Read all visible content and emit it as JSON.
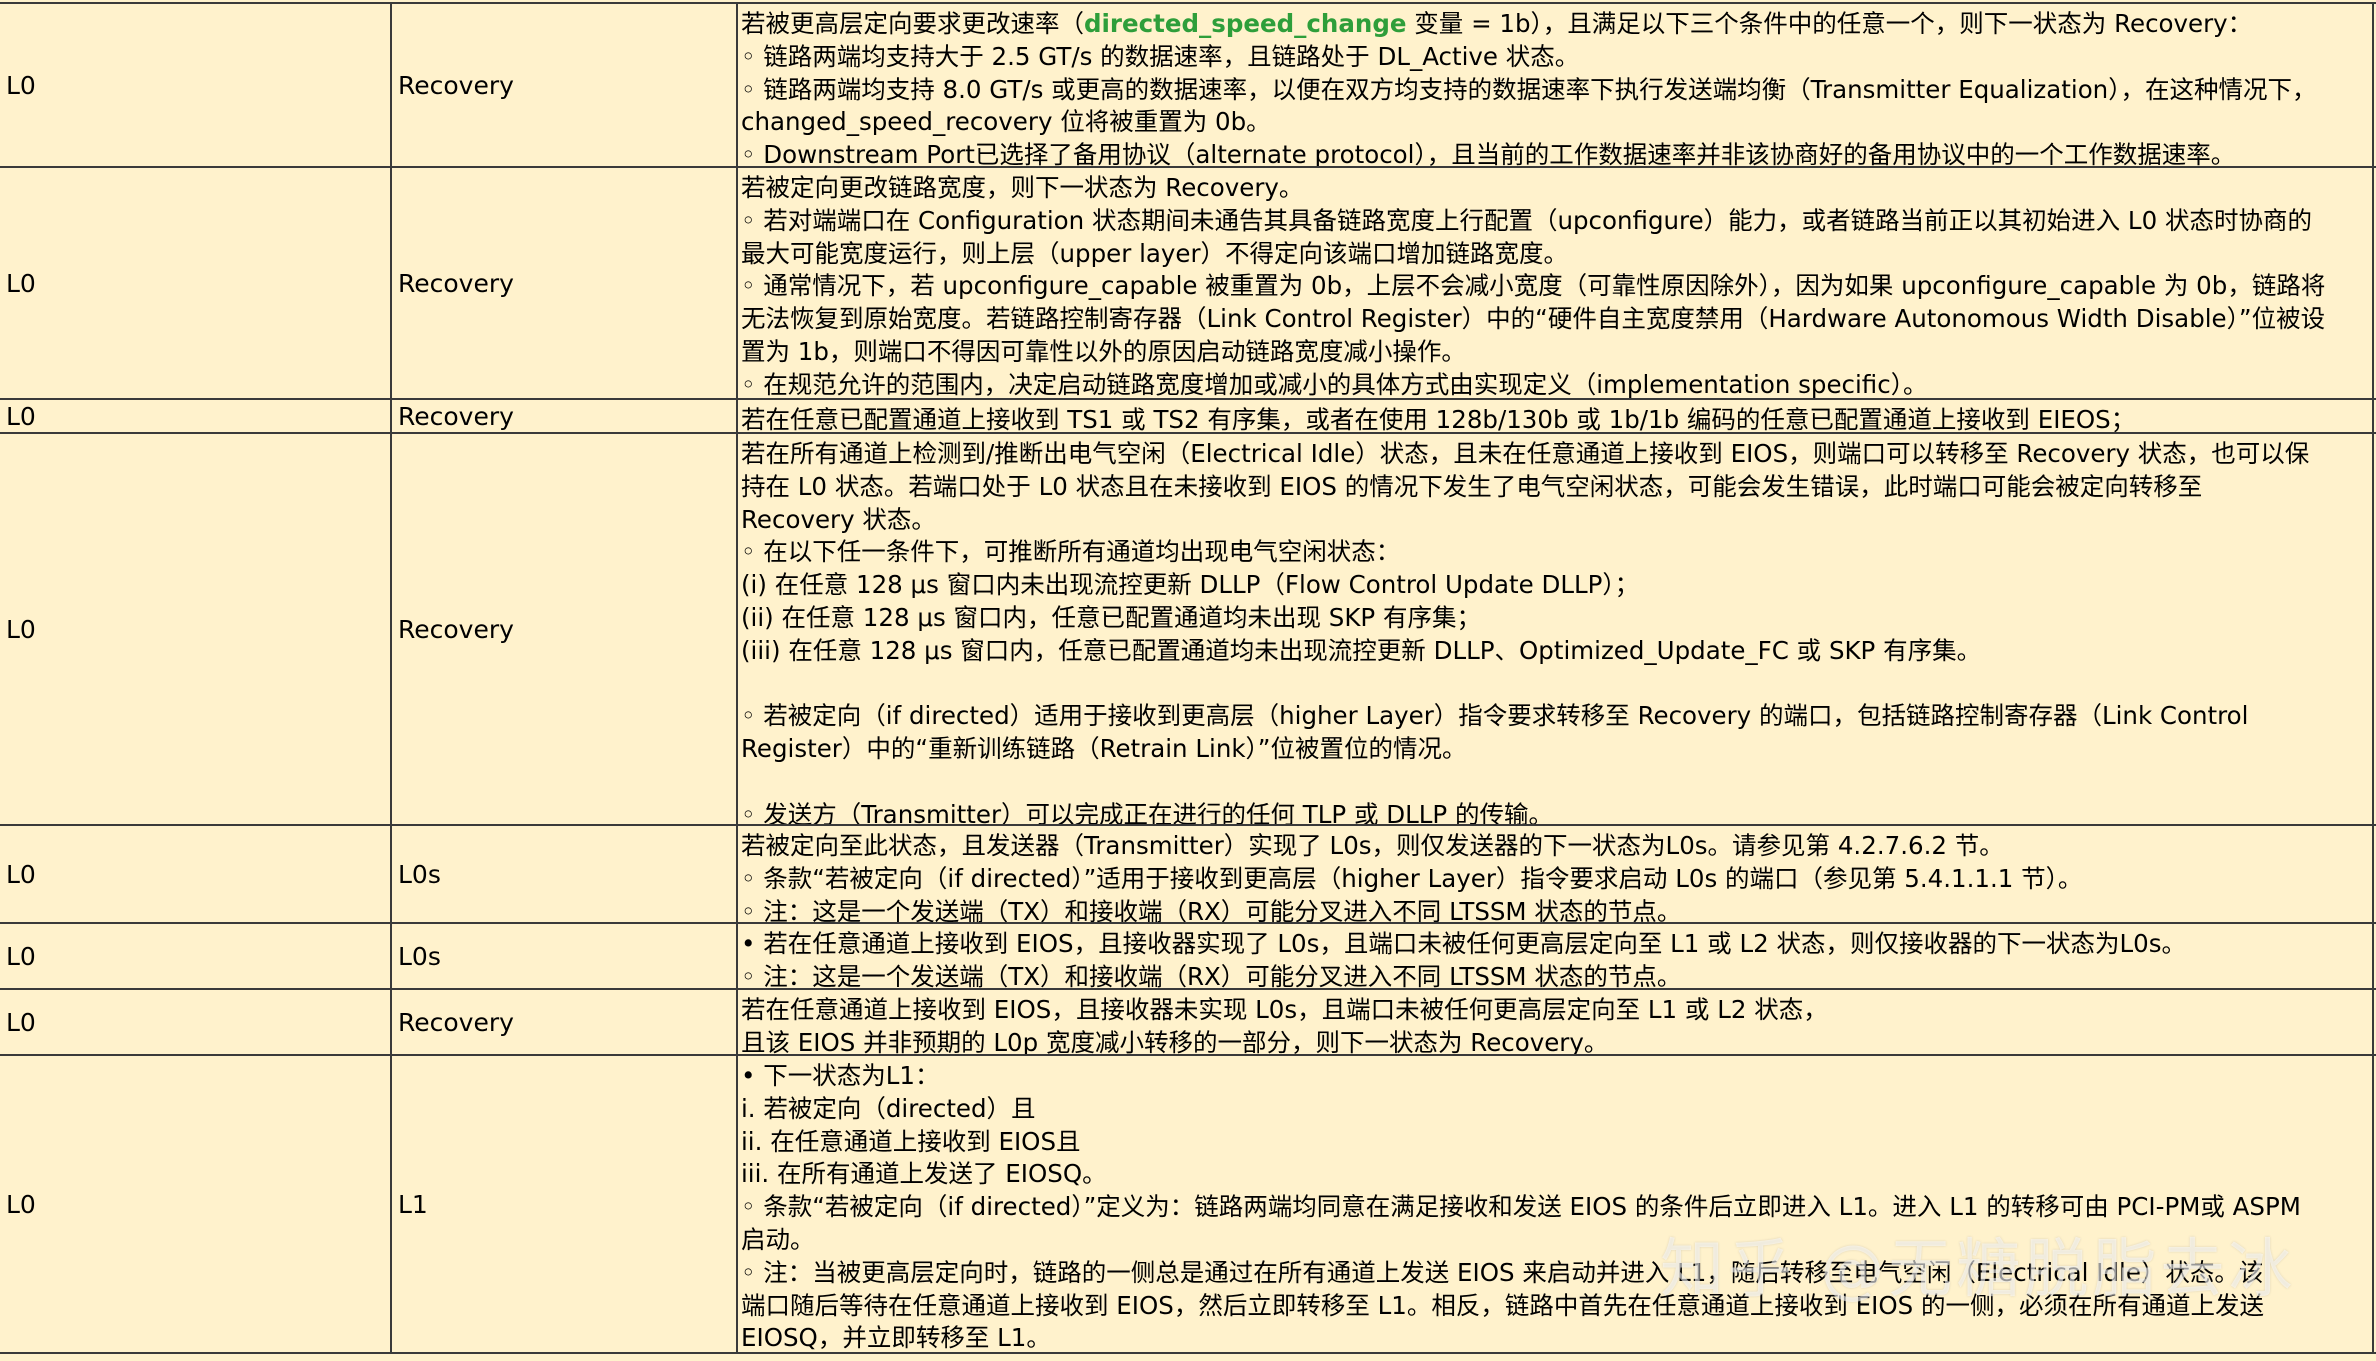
{
  "table": {
    "rows": [
      {
        "from": "L0",
        "to": "Recovery",
        "lines": [
          {
            "parts": [
              {
                "text": "若被更高层定向要求更改速率（",
                "hl": false
              },
              {
                "text": "directed_speed_change",
                "hl": true
              },
              {
                "text": " 变量 = 1b），且满足以下三个条件中的任意一个，则下一状态为 Recovery：",
                "hl": false
              }
            ]
          },
          {
            "parts": [
              {
                "text": "◦ 链路两端均支持大于 2.5 GT/s 的数据速率，且链路处于 DL_Active 状态。",
                "hl": false
              }
            ]
          },
          {
            "parts": [
              {
                "text": "◦ 链路两端均支持 8.0 GT/s 或更高的数据速率，以便在双方均支持的数据速率下执行发送端均衡（Transmitter Equalization），在这种情况下，",
                "hl": false
              }
            ]
          },
          {
            "parts": [
              {
                "text": "changed_speed_recovery 位将被重置为 0b。",
                "hl": false
              }
            ]
          },
          {
            "parts": [
              {
                "text": "◦ Downstream Port已选择了备用协议（alternate protocol），且当前的工作数据速率并非该协商好的备用协议中的一个工作数据速率。",
                "hl": false
              }
            ]
          }
        ]
      },
      {
        "from": "L0",
        "to": "Recovery",
        "lines": [
          {
            "parts": [
              {
                "text": "若被定向更改链路宽度，则下一状态为 Recovery。",
                "hl": false
              }
            ]
          },
          {
            "parts": [
              {
                "text": "◦ 若对端端口在 Configuration 状态期间未通告其具备链路宽度上行配置（upconfigure）能力，或者链路当前正以其初始进入 L0 状态时协商的",
                "hl": false
              }
            ]
          },
          {
            "parts": [
              {
                "text": "最大可能宽度运行，则上层（upper layer）不得定向该端口增加链路宽度。",
                "hl": false
              }
            ]
          },
          {
            "parts": [
              {
                "text": "◦ 通常情况下，若 upconfigure_capable 被重置为 0b，上层不会减小宽度（可靠性原因除外），因为如果 upconfigure_capable 为 0b，链路将",
                "hl": false
              }
            ]
          },
          {
            "parts": [
              {
                "text": "无法恢复到原始宽度。若链路控制寄存器（Link Control Register）中的“硬件自主宽度禁用（Hardware Autonomous Width Disable）”位被设",
                "hl": false
              }
            ]
          },
          {
            "parts": [
              {
                "text": "置为 1b，则端口不得因可靠性以外的原因启动链路宽度减小操作。",
                "hl": false
              }
            ]
          },
          {
            "parts": [
              {
                "text": "◦ 在规范允许的范围内，决定启动链路宽度增加或减小的具体方式由实现定义（implementation specific）。",
                "hl": false
              }
            ]
          }
        ]
      },
      {
        "from": "L0",
        "to": "Recovery",
        "lines": [
          {
            "parts": [
              {
                "text": "若在任意已配置通道上接收到 TS1 或 TS2 有序集，或者在使用 128b/130b 或 1b/1b 编码的任意已配置通道上接收到 EIEOS；",
                "hl": false
              }
            ]
          }
        ]
      },
      {
        "from": "L0",
        "to": "Recovery",
        "lines": [
          {
            "parts": [
              {
                "text": "若在所有通道上检测到/推断出电气空闲（Electrical Idle）状态，且未在任意通道上接收到 EIOS，则端口可以转移至 Recovery 状态，也可以保",
                "hl": false
              }
            ]
          },
          {
            "parts": [
              {
                "text": "持在 L0 状态。若端口处于 L0 状态且在未接收到 EIOS 的情况下发生了电气空闲状态，可能会发生错误，此时端口可能会被定向转移至",
                "hl": false
              }
            ]
          },
          {
            "parts": [
              {
                "text": "Recovery 状态。",
                "hl": false
              }
            ]
          },
          {
            "parts": [
              {
                "text": "◦ 在以下任一条件下，可推断所有通道均出现电气空闲状态：",
                "hl": false
              }
            ]
          },
          {
            "parts": [
              {
                "text": "(i) 在任意 128 μs 窗口内未出现流控更新 DLLP（Flow Control Update DLLP）；",
                "hl": false
              }
            ]
          },
          {
            "parts": [
              {
                "text": "(ii) 在任意 128 μs 窗口内，任意已配置通道均未出现 SKP 有序集；",
                "hl": false
              }
            ]
          },
          {
            "parts": [
              {
                "text": "(iii) 在任意 128 μs 窗口内，任意已配置通道均未出现流控更新 DLLP、Optimized_Update_FC 或 SKP 有序集。",
                "hl": false
              }
            ]
          },
          {
            "parts": [
              {
                "text": "",
                "hl": false
              }
            ]
          },
          {
            "parts": [
              {
                "text": "◦ 若被定向（if directed）适用于接收到更高层（higher Layer）指令要求转移至 Recovery 的端口，包括链路控制寄存器（Link Control",
                "hl": false
              }
            ]
          },
          {
            "parts": [
              {
                "text": "Register）中的“重新训练链路（Retrain Link）”位被置位的情况。",
                "hl": false
              }
            ]
          },
          {
            "parts": [
              {
                "text": "",
                "hl": false
              }
            ]
          },
          {
            "parts": [
              {
                "text": "◦ 发送方（Transmitter）可以完成正在进行的任何 TLP 或 DLLP 的传输。",
                "hl": false
              }
            ]
          }
        ]
      },
      {
        "from": "L0",
        "to": "L0s",
        "lines": [
          {
            "parts": [
              {
                "text": "若被定向至此状态，且发送器（Transmitter）实现了 L0s，则仅发送器的下一状态为L0s。请参见第 4.2.7.6.2 节。",
                "hl": false
              }
            ]
          },
          {
            "parts": [
              {
                "text": "◦ 条款“若被定向（if directed）”适用于接收到更高层（higher Layer）指令要求启动 L0s 的端口（参见第 5.4.1.1.1 节）。",
                "hl": false
              }
            ]
          },
          {
            "parts": [
              {
                "text": "◦ 注：这是一个发送端（TX）和接收端（RX）可能分叉进入不同 LTSSM 状态的节点。",
                "hl": false
              }
            ]
          }
        ]
      },
      {
        "from": "L0",
        "to": "L0s",
        "lines": [
          {
            "parts": [
              {
                "text": "• 若在任意通道上接收到 EIOS，且接收器实现了 L0s，且端口未被任何更高层定向至 L1 或 L2 状态，则仅接收器的下一状态为L0s。",
                "hl": false
              }
            ]
          },
          {
            "parts": [
              {
                "text": "◦ 注：这是一个发送端（TX）和接收端（RX）可能分叉进入不同 LTSSM 状态的节点。",
                "hl": false
              }
            ]
          }
        ]
      },
      {
        "from": "L0",
        "to": "Recovery",
        "lines": [
          {
            "parts": [
              {
                "text": "若在任意通道上接收到 EIOS，且接收器未实现 L0s，且端口未被任何更高层定向至 L1 或 L2 状态，",
                "hl": false
              }
            ]
          },
          {
            "parts": [
              {
                "text": "且该 EIOS 并非预期的 L0p 宽度减小转移的一部分，则下一状态为 Recovery。",
                "hl": false
              }
            ]
          }
        ]
      },
      {
        "from": "L0",
        "to": "L1",
        "lines": [
          {
            "parts": [
              {
                "text": "• 下一状态为L1：",
                "hl": false
              }
            ]
          },
          {
            "parts": [
              {
                "text": "i. 若被定向（directed）且",
                "hl": false
              }
            ]
          },
          {
            "parts": [
              {
                "text": "ii. 在任意通道上接收到 EIOS且",
                "hl": false
              }
            ]
          },
          {
            "parts": [
              {
                "text": "iii. 在所有通道上发送了 EIOSQ。",
                "hl": false
              }
            ]
          },
          {
            "parts": [
              {
                "text": "◦ 条款“若被定向（if directed）”定义为：链路两端均同意在满足接收和发送 EIOS 的条件后立即进入 L1。进入 L1 的转移可由 PCI-PM或 ASPM",
                "hl": false
              }
            ]
          },
          {
            "parts": [
              {
                "text": "启动。",
                "hl": false
              }
            ]
          },
          {
            "parts": [
              {
                "text": "◦ 注：当被更高层定向时，链路的一侧总是通过在所有通道上发送 EIOS 来启动并进入 L1，随后转移至电气空闲（Electrical Idle）状态。该",
                "hl": false
              }
            ]
          },
          {
            "parts": [
              {
                "text": "端口随后等待在任意通道上接收到 EIOS，然后立即转移至 L1。相反，链路中首先在任意通道上接收到 EIOS 的一侧，必须在所有通道上发送",
                "hl": false
              }
            ]
          },
          {
            "parts": [
              {
                "text": "EIOSQ，并立即转移至 L1。",
                "hl": false
              }
            ]
          }
        ]
      }
    ]
  },
  "watermark": "知乎 @无糖脱脂去冰",
  "colors": {
    "cell_background": "#FFF2CC",
    "highlight_text": "#2E9E3A",
    "grid_line": "#3a3a3a"
  }
}
